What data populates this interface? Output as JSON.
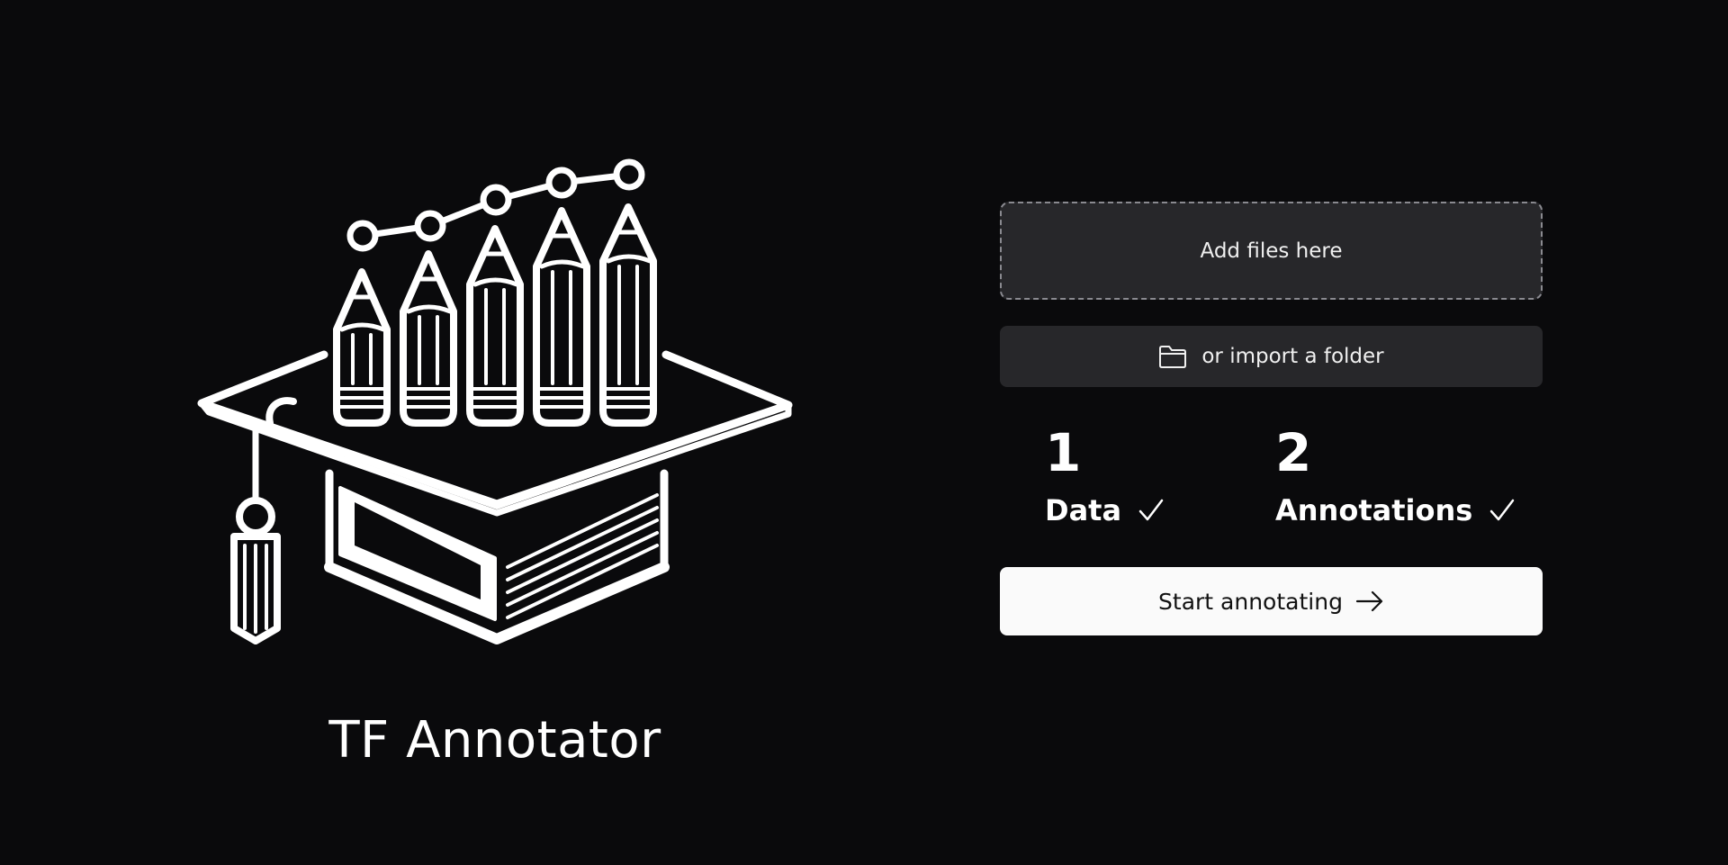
{
  "app": {
    "title": "TF Annotator"
  },
  "logo": {
    "icon": "graduation-cap-pencil-chart-icon"
  },
  "upload": {
    "dropzone_label": "Add files here",
    "import_folder_label": "or import a folder",
    "import_icon": "folder-icon"
  },
  "stats": {
    "data": {
      "number": "1",
      "label": "Data",
      "icon": "check-icon"
    },
    "annotations": {
      "number": "2",
      "label": "Annotations",
      "icon": "check-icon"
    }
  },
  "actions": {
    "start_label": "Start annotating",
    "start_icon": "arrow-right-icon"
  },
  "colors": {
    "background": "#0a0a0c",
    "panel": "#27272a",
    "primary_button": "#fafafa",
    "text": "#ffffff"
  }
}
